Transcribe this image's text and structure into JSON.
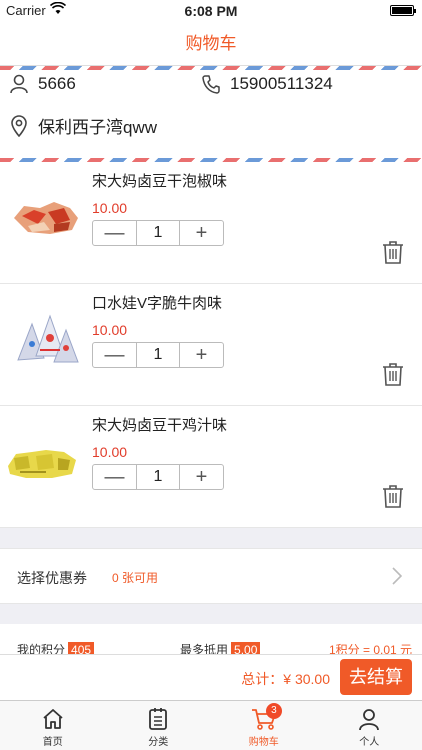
{
  "status_bar": {
    "carrier": "Carrier",
    "time": "6:08 PM"
  },
  "nav": {
    "title": "购物车"
  },
  "address": {
    "name": "5666",
    "phone": "15900511324",
    "location": "保利西子湾qww"
  },
  "cart": {
    "items": [
      {
        "name": "宋大妈卤豆干泡椒味",
        "price": "10.00",
        "quantity": "1",
        "minus": "—",
        "plus": "+"
      },
      {
        "name": "口水娃V字脆牛肉味",
        "price": "10.00",
        "quantity": "1",
        "minus": "—",
        "plus": "+"
      },
      {
        "name": "宋大妈卤豆干鸡汁味",
        "price": "10.00",
        "quantity": "1",
        "minus": "—",
        "plus": "+"
      }
    ]
  },
  "coupon": {
    "label": "选择优惠券",
    "count": "0 张可用"
  },
  "points": {
    "mine_label": "我的积分",
    "mine_value": "405",
    "deduct_label": "最多抵用",
    "deduct_value": "5.00",
    "rule": "1积分 = 0.01 元"
  },
  "checkout": {
    "total": "总计：¥ 30.00",
    "button": "去结算"
  },
  "tabs": [
    {
      "label": "首页",
      "icon": "home-icon"
    },
    {
      "label": "分类",
      "icon": "list-icon"
    },
    {
      "label": "购物车",
      "icon": "cart-icon",
      "badge": "3",
      "active": true
    },
    {
      "label": "个人",
      "icon": "person-icon"
    }
  ],
  "colors": {
    "accent": "#f05a28",
    "price": "#e13c2a"
  }
}
